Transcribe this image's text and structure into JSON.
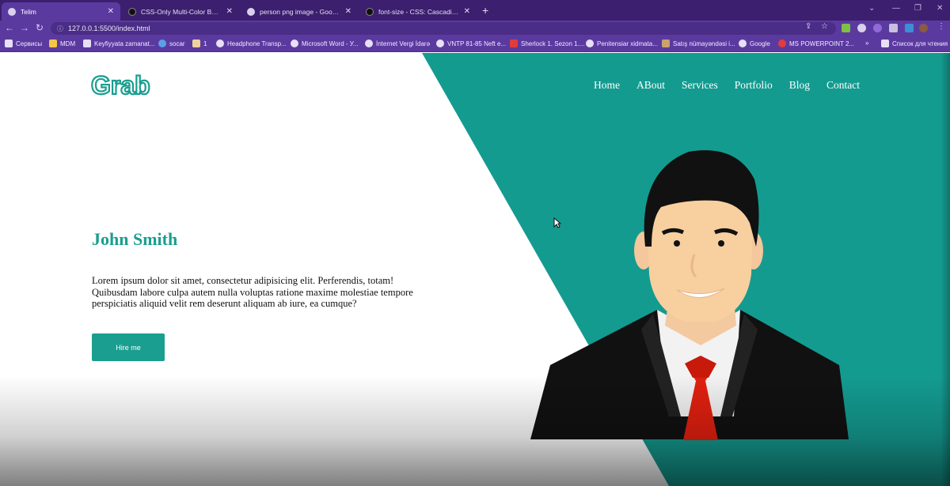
{
  "browser": {
    "tabs": [
      {
        "title": "Telim",
        "active": true
      },
      {
        "title": "CSS-Only Multi-Color Backgroun",
        "active": false
      },
      {
        "title": "person png image - Google Axta",
        "active": false
      },
      {
        "title": "font-size - CSS: Cascading Style",
        "active": false
      }
    ],
    "new_tab": "+",
    "url": "127.0.0.1:5500/index.html",
    "bookmarks": [
      "Сервисы",
      "MDM",
      "Keyfiyyata zamanat...",
      "socar",
      "1",
      "Headphone Transp...",
      "Microsoft Word - У...",
      "İnternet Vergi İdarə",
      "VNTP 81-85 Neft e...",
      "Sherlock 1. Sezon 1....",
      "Penitensiar xidmata...",
      "Satış nümayəndəsi i...",
      "Google",
      "MS POWERPOINT 2..."
    ],
    "bookmarks_more": "»",
    "reading_list": "Список для чтения"
  },
  "site": {
    "logo_text": "Grab",
    "nav": [
      "Home",
      "ABout",
      "Services",
      "Portfolio",
      "Blog",
      "Contact"
    ],
    "hero": {
      "name": "John Smith",
      "text": "Lorem ipsum dolor sit amet, consectetur adipisicing elit. Perferendis, totam! Quibusdam labore culpa autem nulla voluptas ratione maxime molestiae tempore perspiciatis aliquid velit rem deserunt aliquam ab iure, ea cumque?",
      "button": "Hire me"
    }
  },
  "colors": {
    "accent": "#1a9e8f",
    "tab_bar": "#3c1f6e",
    "toolbar": "#5b3aa0"
  }
}
